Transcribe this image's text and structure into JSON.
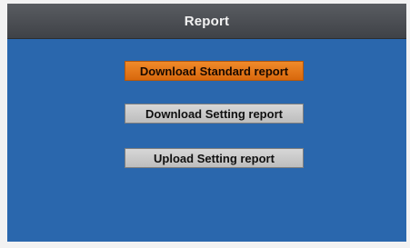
{
  "header": {
    "title": "Report"
  },
  "menu": {
    "items": [
      {
        "label": "Download Standard report",
        "selected": true
      },
      {
        "label": "Download Setting report",
        "selected": false
      },
      {
        "label": "Upload Setting report",
        "selected": false
      }
    ]
  },
  "colors": {
    "screen_bg": "#2a67ad",
    "titlebar_bg": "#4c4f54",
    "selected_bg": "#e67a1c",
    "button_bg": "#cccccc"
  }
}
